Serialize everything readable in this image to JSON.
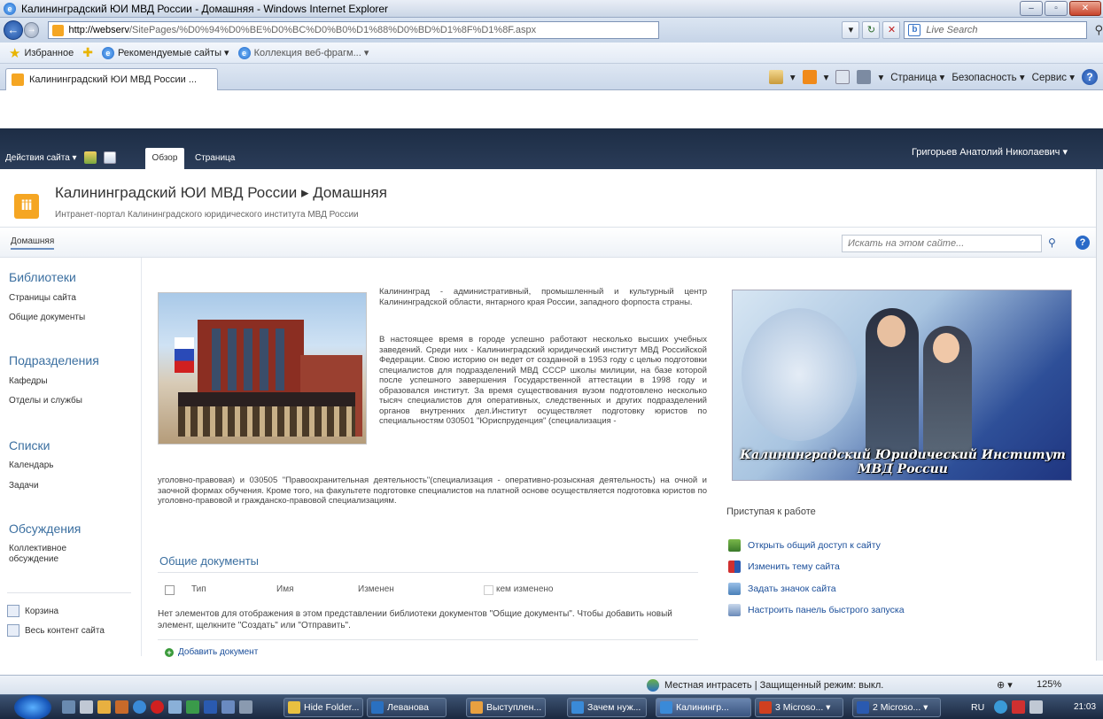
{
  "browser": {
    "window_title": "Калининградский ЮИ МВД России - Домашняя - Windows Internet Explorer",
    "url_domain": "http://webserv",
    "url_path": "/SitePages/%D0%94%D0%BE%D0%BC%D0%B0%D1%88%D0%BD%D1%8F%D1%8F.aspx",
    "search_placeholder": "Live Search",
    "favorites_label": "Избранное",
    "recommended_sites": "Рекомендуемые сайты ▾",
    "web_slice_gallery": "Коллекция веб-фрагм... ▾",
    "tab_title": "Калининградский ЮИ МВД России ...",
    "cmd_page": "Страница ▾",
    "cmd_safety": "Безопасность ▾",
    "cmd_tools": "Сервис ▾"
  },
  "sharepoint": {
    "site_actions": "Действия сайта ▾",
    "tab_overview": "Обзор",
    "tab_page": "Страница",
    "user_name": "Григорьев Анатолий Николаевич ▾",
    "site_title": "Калининградский ЮИ МВД России ▸ Домашняя",
    "site_subtitle": "Интранет-портал Калининградского юридического института МВД России",
    "nav_home": "Домашняя",
    "search_placeholder": "Искать на этом сайте..."
  },
  "quick_launch": {
    "libraries": "Библиотеки",
    "site_pages": "Страницы сайта",
    "shared_docs": "Общие документы",
    "departments": "Подразделения",
    "chairs": "Кафедры",
    "divisions": "Отделы и службы",
    "lists": "Списки",
    "calendar": "Календарь",
    "tasks": "Задачи",
    "discussions": "Обсуждения",
    "team_discussion_1": "Коллективное",
    "team_discussion_2": "обсуждение",
    "recycle_bin": "Корзина",
    "all_content": "Весь контент сайта"
  },
  "content": {
    "para1": "Калининград - административный, промышленный и культурный центр Калининградской области, янтарного края России, западного форпоста страны.",
    "para2": "В настоящее время в городе успешно работают несколько высших учебных заведений. Среди них - Калининградский юридический институт МВД Российской Федерации. Свою историю он ведет от созданной в 1953 году с целью подготовки специалистов для подразделений МВД СССР школы милиции, на базе которой после успешного завершения Государственной аттестации в 1998 году и образовался институт. За время существования вузом подготовлено несколько тысяч специалистов для оперативных, следственных и других подразделений органов внутренних дел.Институт осуществляет подготовку юристов по специальностям 030501 \"Юриспруденция\" (специализация -",
    "para3": "уголовно-правовая) и 030505 \"Правоохранительная деятельность\"(специализация - оперативно-розыскная деятельность) на очной и заочной формах обучения. Кроме того, на факультете подготовке специалистов на платной основе осуществляется подготовка юристов по уголовно-правовой и гражданско-правовой специализациям.",
    "banner_text": "Калининградский Юридический Институт МВД России",
    "getting_started": "Приступая к работе",
    "gs_share": "Открыть общий доступ к сайту",
    "gs_theme": "Изменить тему сайта",
    "gs_icon": "Задать значок сайта",
    "gs_quicklaunch": "Настроить панель быстрого запуска"
  },
  "docs": {
    "title": "Общие документы",
    "col_type": "Тип",
    "col_name": "Имя",
    "col_modified": "Изменен",
    "col_modified_by": "кем изменено",
    "empty_message": "Нет элементов для отображения в этом представлении библиотеки документов \"Общие документы\". Чтобы добавить новый элемент, щелкните \"Создать\" или \"Отправить\".",
    "add_document": "Добавить документ"
  },
  "status": {
    "zone": "Местная интрасеть | Защищенный режим: выкл.",
    "zoom": "125%"
  },
  "taskbar": {
    "t1": "Hide Folder...",
    "t2": "Леванова",
    "t3": "Выступлен...",
    "t4": "Зачем нуж...",
    "t5": "Калинингр...",
    "t6": "3 Microso... ▾",
    "t7": "2 Microso... ▾",
    "lang": "RU",
    "clock": "21:03"
  }
}
